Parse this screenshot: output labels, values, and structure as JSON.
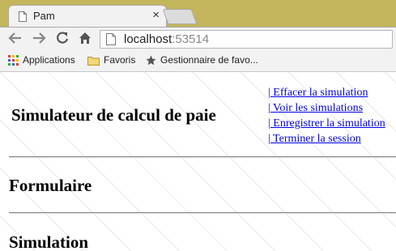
{
  "browser": {
    "tab_title": "Pam",
    "tab_close": "×",
    "url_host": "localhost",
    "url_port": ":53514",
    "bookmarks": [
      {
        "label": "Applications",
        "icon": "apps-grid-icon"
      },
      {
        "label": "Favoris",
        "icon": "folder-icon"
      },
      {
        "label": "Gestionnaire de favo...",
        "icon": "star-icon"
      }
    ]
  },
  "page": {
    "title": "Simulateur de calcul de paie",
    "menu_links": [
      "| Effacer la simulation",
      "| Voir les simulations",
      "| Enregistrer la simulation",
      "| Terminer la session"
    ],
    "section_form": "Formulaire",
    "section_simulation": "Simulation"
  },
  "colors": {
    "link": "#0000ee",
    "chrome_frame": "#c3b55a"
  }
}
